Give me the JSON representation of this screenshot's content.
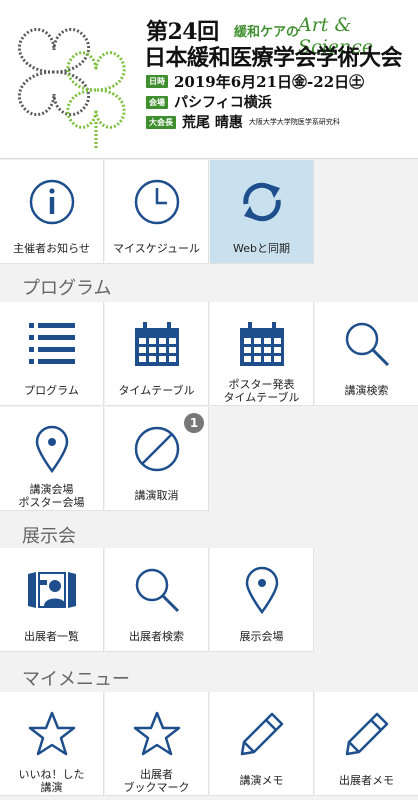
{
  "banner": {
    "conf_number": "第24回",
    "conf_tagline": "緩和ケアの",
    "conf_art": "Art & Science",
    "conf_title": "日本緩和医療学会学術大会",
    "date_badge": "日時",
    "date_text": "2019年6月21日㊎-22日㊏",
    "venue_badge": "会場",
    "venue_text": "パシフィコ横浜",
    "chair_badge": "大会長",
    "chair_name": "荒尾 晴惠",
    "chair_affiliation": "大阪大学大学院医学系研究科"
  },
  "top_menu": [
    {
      "label": "主催者お知らせ",
      "icon": "info-icon"
    },
    {
      "label": "マイスケジュール",
      "icon": "clock-icon"
    },
    {
      "label": "Webと同期",
      "icon": "sync-icon"
    }
  ],
  "sections": {
    "program": "プログラム",
    "exhibition": "展示会",
    "mymenu": "マイメニュー"
  },
  "program_items": [
    {
      "label": "プログラム",
      "icon": "list-icon"
    },
    {
      "label": "タイムテーブル",
      "icon": "calendar-icon"
    },
    {
      "label1": "ポスター発表",
      "label2": "タイムテーブル",
      "icon": "calendar-icon"
    },
    {
      "label": "講演検索",
      "icon": "search-icon"
    },
    {
      "label1": "講演会場",
      "label2": "ポスター会場",
      "icon": "location-pin-icon"
    },
    {
      "label": "講演取消",
      "icon": "cancel-icon",
      "badge": "1"
    }
  ],
  "exhibition_items": [
    {
      "label": "出展者一覧",
      "icon": "exhibitor-booth-icon"
    },
    {
      "label": "出展者検索",
      "icon": "search-icon"
    },
    {
      "label": "展示会場",
      "icon": "location-pin-icon"
    }
  ],
  "mymenu_items": [
    {
      "label1": "いいね！した",
      "label2": "講演",
      "icon": "star-icon"
    },
    {
      "label1": "出展者",
      "label2": "ブックマーク",
      "icon": "star-icon"
    },
    {
      "label": "講演メモ",
      "icon": "pencil-icon"
    },
    {
      "label": "出展者メモ",
      "icon": "pencil-icon"
    }
  ],
  "colors": {
    "icon_blue": "#1e4f8c",
    "accent_green": "#3f8f2e",
    "active_bg": "#c9e1ee"
  }
}
